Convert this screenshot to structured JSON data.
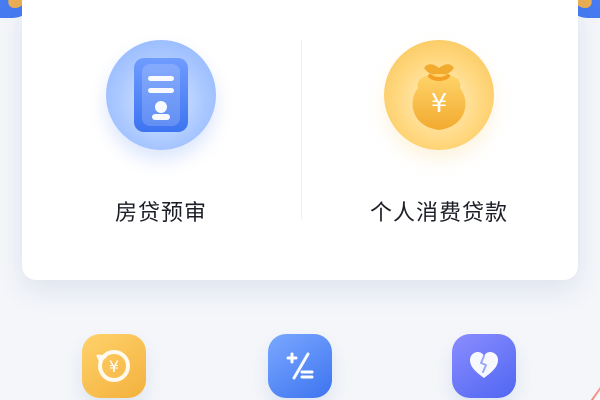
{
  "main_card": {
    "items": [
      {
        "label": "房贷预审",
        "icon": "document-stamp-icon"
      },
      {
        "label": "个人消费贷款",
        "icon": "money-bag-icon",
        "icon_text": "¥"
      }
    ]
  },
  "bottom_icons": [
    {
      "icon": "yen-refresh-icon",
      "icon_text": "¥"
    },
    {
      "icon": "calculator-plus-slash-equals-icon"
    },
    {
      "icon": "heart-icon"
    }
  ],
  "colors": {
    "primary_blue": "#3d74f0",
    "gold": "#f3b24a",
    "violet": "#4f66f2"
  }
}
